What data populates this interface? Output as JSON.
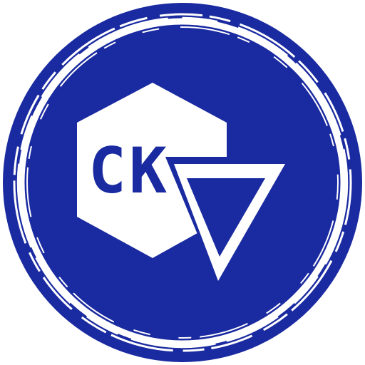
{
  "logo": {
    "monogram": "CK",
    "colors": {
      "primary_blue": "#1a2aa0",
      "white": "#ffffff"
    },
    "icons": [
      "hexagon-shape",
      "down-triangle-icon",
      "brush-stroke-ring"
    ]
  }
}
